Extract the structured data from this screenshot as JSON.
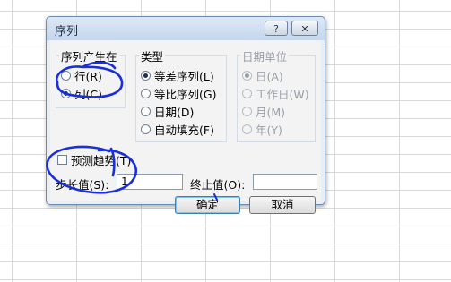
{
  "dialog": {
    "title": "序列",
    "help_label": "?",
    "close_label": "✕"
  },
  "series_in": {
    "title": "序列产生在",
    "options": [
      {
        "label": "行(R)",
        "selected": false
      },
      {
        "label": "列(C)",
        "selected": true
      }
    ]
  },
  "type": {
    "title": "类型",
    "options": [
      {
        "label": "等差序列(L)",
        "selected": true
      },
      {
        "label": "等比序列(G)",
        "selected": false
      },
      {
        "label": "日期(D)",
        "selected": false
      },
      {
        "label": "自动填充(F)",
        "selected": false
      }
    ]
  },
  "date_unit": {
    "title": "日期单位",
    "enabled": false,
    "options": [
      {
        "label": "日(A)",
        "selected": true
      },
      {
        "label": "工作日(W)",
        "selected": false
      },
      {
        "label": "月(M)",
        "selected": false
      },
      {
        "label": "年(Y)",
        "selected": false
      }
    ]
  },
  "trend": {
    "label": "预测趋势(T)",
    "checked": false
  },
  "step": {
    "label": "步长值(S):",
    "value": "1"
  },
  "stop": {
    "label": "终止值(O):",
    "value": ""
  },
  "buttons": {
    "ok": "确定",
    "cancel": "取消"
  },
  "annotation_color": "#1a2fd6"
}
